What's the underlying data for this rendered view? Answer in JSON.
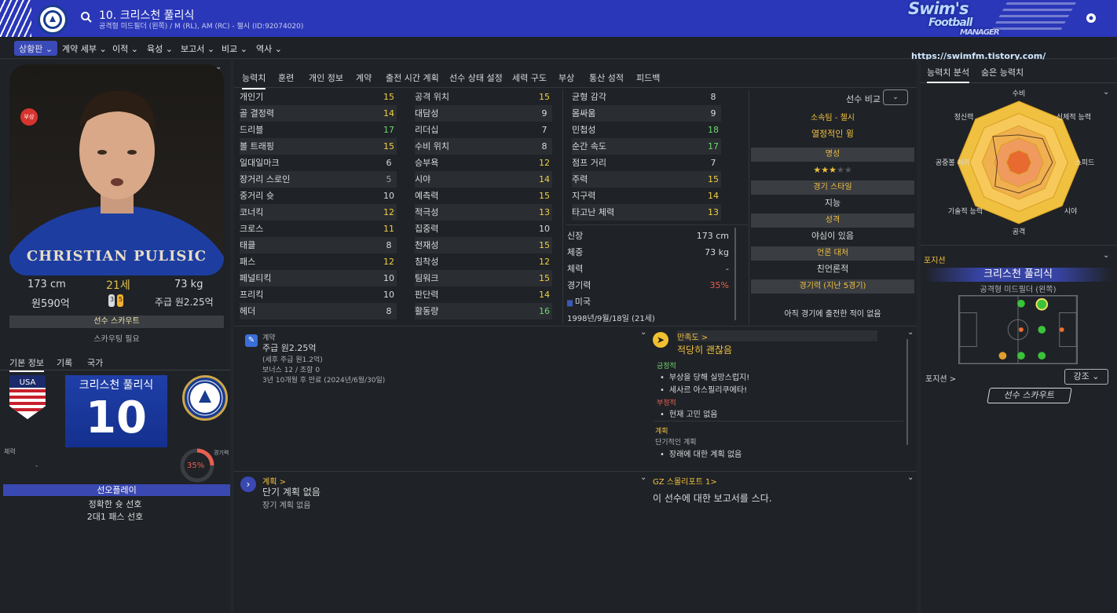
{
  "header": {
    "title": "10. 크리스천 풀리식",
    "subtitle": "공격형 미드필더 (왼쪽) / M (RL), AM (RC) - 첼시 (ID:92074020)",
    "logo_line1": "Swim's",
    "logo_line2": "Football",
    "logo_line3": "MANAGER",
    "url": "https://swimfm.tistory.com/"
  },
  "nav": [
    {
      "label": "상황판 ⌄",
      "active": true
    },
    {
      "label": "계약 세부 ⌄"
    },
    {
      "label": "이적 ⌄"
    },
    {
      "label": "육성 ⌄"
    },
    {
      "label": "보고서 ⌄"
    },
    {
      "label": "비교 ⌄"
    },
    {
      "label": "역사 ⌄"
    }
  ],
  "profile": {
    "photo_name": "CHRISTIAN PULISIC",
    "injury_badge": "부상",
    "height": "173 cm",
    "age": "21세",
    "weight": "73 kg",
    "value": "원590억",
    "wage": "주급 원2.25억",
    "boot_left": "3",
    "boot_right": "5",
    "scout_label": "선수 스카우트",
    "scout_need": "스카우팅 필요"
  },
  "left_tabs": [
    "기본 정보",
    "기록",
    "국가"
  ],
  "shirt": {
    "name": "크리스천 풀리식",
    "number": "10"
  },
  "fitness": {
    "label": "체력",
    "value": "-"
  },
  "match_sharpness": {
    "label": "경기력",
    "value": "35%"
  },
  "preferred": {
    "title": "선오플레이",
    "items": [
      "정확한 슛 선호",
      "2대1 패스 선호"
    ]
  },
  "tabs": [
    "능력치",
    "훈련",
    "개인 정보",
    "계약",
    "출전 시간 계획",
    "선수 상태 설정",
    "세력 구도",
    "부상",
    "통산 성적",
    "피드백"
  ],
  "attributes": {
    "col1": [
      {
        "name": "개인기",
        "value": "15",
        "color": "#f0d040"
      },
      {
        "name": "골 결정력",
        "value": "14",
        "color": "#f0d040"
      },
      {
        "name": "드리블",
        "value": "17",
        "color": "#6fd86f"
      },
      {
        "name": "볼 트래핑",
        "value": "15",
        "color": "#f0d040"
      },
      {
        "name": "일대일마크",
        "value": "6",
        "color": "#d8dadd"
      },
      {
        "name": "장거리 스로인",
        "value": "5",
        "color": "#9a9ea4"
      },
      {
        "name": "중거리 슛",
        "value": "10",
        "color": "#d8dadd"
      },
      {
        "name": "코너킥",
        "value": "12",
        "color": "#f0d040"
      },
      {
        "name": "크로스",
        "value": "11",
        "color": "#f0d040"
      },
      {
        "name": "태클",
        "value": "8",
        "color": "#d8dadd"
      },
      {
        "name": "패스",
        "value": "12",
        "color": "#f0d040"
      },
      {
        "name": "페널티킥",
        "value": "10",
        "color": "#d8dadd"
      },
      {
        "name": "프리킥",
        "value": "10",
        "color": "#d8dadd"
      },
      {
        "name": "헤더",
        "value": "8",
        "color": "#d8dadd"
      }
    ],
    "col2": [
      {
        "name": "공격 위치",
        "value": "15",
        "color": "#f0d040"
      },
      {
        "name": "대담성",
        "value": "9",
        "color": "#d8dadd"
      },
      {
        "name": "리더십",
        "value": "7",
        "color": "#d8dadd"
      },
      {
        "name": "수비 위치",
        "value": "8",
        "color": "#d8dadd"
      },
      {
        "name": "승부욕",
        "value": "12",
        "color": "#f0d040"
      },
      {
        "name": "시야",
        "value": "14",
        "color": "#f0d040"
      },
      {
        "name": "예측력",
        "value": "15",
        "color": "#f0d040"
      },
      {
        "name": "적극성",
        "value": "13",
        "color": "#f0d040"
      },
      {
        "name": "집중력",
        "value": "10",
        "color": "#d8dadd"
      },
      {
        "name": "천재성",
        "value": "15",
        "color": "#f0d040"
      },
      {
        "name": "침착성",
        "value": "12",
        "color": "#f0d040"
      },
      {
        "name": "팀워크",
        "value": "15",
        "color": "#f0d040"
      },
      {
        "name": "판단력",
        "value": "14",
        "color": "#f0d040"
      },
      {
        "name": "활동량",
        "value": "16",
        "color": "#6fd86f"
      }
    ],
    "col3": [
      {
        "name": "균형 감각",
        "value": "8",
        "color": "#d8dadd"
      },
      {
        "name": "몸싸움",
        "value": "9",
        "color": "#d8dadd"
      },
      {
        "name": "민첩성",
        "value": "18",
        "color": "#6fd86f"
      },
      {
        "name": "순간 속도",
        "value": "17",
        "color": "#6fd86f"
      },
      {
        "name": "점프 거리",
        "value": "7",
        "color": "#d8dadd"
      },
      {
        "name": "주력",
        "value": "15",
        "color": "#f0d040"
      },
      {
        "name": "지구력",
        "value": "14",
        "color": "#f0d040"
      },
      {
        "name": "타고난 체력",
        "value": "13",
        "color": "#f0d040"
      }
    ]
  },
  "info": [
    {
      "name": "신장",
      "value": "173 cm",
      "color": "#d8dadd"
    },
    {
      "name": "체중",
      "value": "73 kg",
      "color": "#d8dadd"
    },
    {
      "name": "체력",
      "value": "-",
      "color": "#d8dadd"
    },
    {
      "name": "경기력",
      "value": "35%",
      "color": "#e86050"
    },
    {
      "name": "미국",
      "value": "",
      "color": "#d8dadd"
    },
    {
      "name": "1998년/9월/18일 (21세)",
      "value": "",
      "color": "#d8dadd"
    }
  ],
  "compare": {
    "label": "선수 비교"
  },
  "club_info": [
    {
      "header": "소속팀 - 첼시",
      "body": "열정적인 윙",
      "body_color": "#f0c040"
    },
    {
      "header": "명성",
      "body": "★★★★★",
      "stars": 3
    },
    {
      "header": "경기 스타일",
      "body": "지능"
    },
    {
      "header": "성격",
      "body": "야심이 있음"
    },
    {
      "header": "언론 대처",
      "body": "친언론적"
    },
    {
      "header": "경기력 (지난 5경기)",
      "body": "아직 경기에 출전한 적이 없음"
    }
  ],
  "contract": {
    "title": "계약",
    "wage": "주급 원2.25억",
    "after_tax": "(세후 주급 원1.2억)",
    "bonus": "보너스 12 / 조항 0",
    "expiry": "3년 10개월 후 만료 (2024년/6월/30일)"
  },
  "satisfaction": {
    "title": "만족도 >",
    "status": "적당히 괜찮음",
    "positive_label": "긍정적",
    "positives": [
      "부상을 당해 실망스럽지!",
      "세사르 아스필리쿠에타!"
    ],
    "negative_label": "부정적",
    "negatives": [
      "현재 고민 없음"
    ],
    "plan_label": "계획",
    "plan_sub": "단기적인 계획",
    "plan_items": [
      "장래에 대한 계획 없음"
    ]
  },
  "plan": {
    "title": "계획 >",
    "short": "단기 계획 없음",
    "long": "장기 계획 없음"
  },
  "report": {
    "title": "GZ 스몰리포트 1>",
    "body": "이 선수에 대한 보고서를 스다."
  },
  "right_tabs": [
    "능력치 분석",
    "숨은 능력치"
  ],
  "radar": {
    "labels": [
      "수비",
      "신체적 능력",
      "스피드",
      "시야",
      "공격",
      "기술적 능력",
      "공중볼 처리",
      "정신력"
    ],
    "values": [
      0.45,
      0.55,
      0.55,
      0.5,
      0.5,
      0.55,
      0.35,
      0.6
    ]
  },
  "position": {
    "header": "포지션",
    "name": "크리스천 풀리식",
    "sub": "공격형 미드필더 (왼쪽)",
    "label": "포지션 >",
    "strength_btn": "강조 ⌄",
    "scout_btn": "선수 스카우트"
  }
}
